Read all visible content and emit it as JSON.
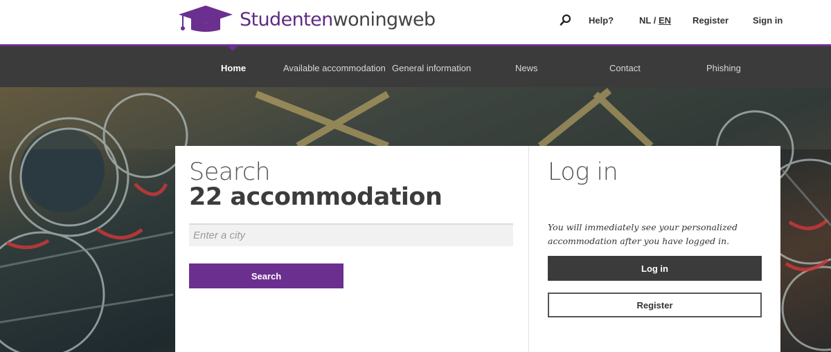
{
  "brand": {
    "name_part1": "Studenten",
    "name_part2": "woningweb",
    "logo_icon": "graduation-cap-icon",
    "accent_color": "#6b2f8f"
  },
  "header": {
    "search_icon": "search-icon",
    "help": "Help?",
    "lang_nl": "NL",
    "lang_sep": " / ",
    "lang_en": "EN",
    "register": "Register",
    "sign_in": "Sign in"
  },
  "nav": {
    "items": [
      {
        "label": "Home",
        "active": true
      },
      {
        "label": "Available accommodation"
      },
      {
        "label": "General information"
      },
      {
        "label": "News"
      },
      {
        "label": "Contact"
      },
      {
        "label": "Phishing"
      }
    ]
  },
  "search_panel": {
    "title": "Search",
    "count_line": "22 accommodation",
    "city_placeholder": "Enter a city",
    "city_value": "",
    "button": "Search"
  },
  "login_panel": {
    "title": "Log in",
    "note": "You will immediately see your personalized accommodation after you have logged in.",
    "login_button": "Log in",
    "register_button": "Register"
  }
}
